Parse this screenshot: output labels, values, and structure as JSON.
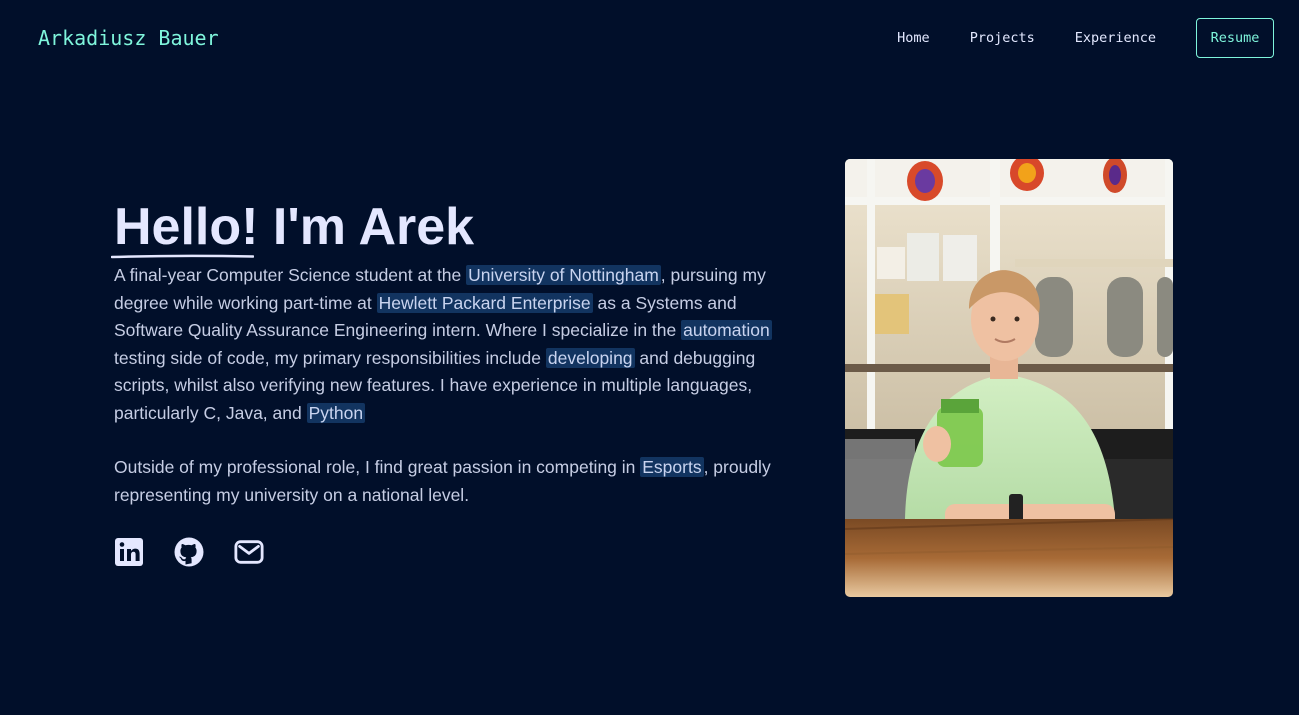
{
  "brand": {
    "name": "Arkadiusz Bauer"
  },
  "nav": {
    "links": [
      "Home",
      "Projects",
      "Experience"
    ],
    "resume_label": "Resume"
  },
  "hero": {
    "title": "Hello! I'm Arek",
    "para1": {
      "t1": "A final-year Computer Science student at the ",
      "h1": "University of Nottingham",
      "t2": ", pursuing my degree while working part-time at ",
      "h2": "Hewlett Packard Enterprise",
      "t3": " as a Systems and Software Quality Assurance Engineering intern. Where I specialize in the ",
      "h3": "automation",
      "t4": " testing side of code, my primary responsibilities include ",
      "h4": "developing",
      "t5": " and debugging scripts, whilst also verifying new features. I have experience in multiple languages, particularly C, Java, and ",
      "h5": "Python"
    },
    "para2": {
      "t1": "Outside of my professional role, I find great passion in competing in ",
      "h1": "Esports",
      "t2": ", proudly representing my university on a national level."
    }
  },
  "socials": [
    {
      "icon": "linkedin-icon"
    },
    {
      "icon": "github-icon"
    },
    {
      "icon": "mail-icon"
    }
  ],
  "colors": {
    "background": "#010f2a",
    "accent": "#7ff5dc",
    "highlight": "#21548c"
  }
}
